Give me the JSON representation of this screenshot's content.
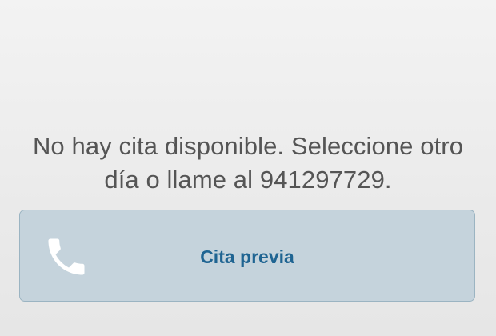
{
  "message": {
    "line1": "No hay cita disponible. Seleccione otro",
    "line2": "día o llame al 941297729."
  },
  "button": {
    "label": "Cita previa",
    "icon": "phone-icon"
  },
  "colors": {
    "message_text": "#555555",
    "button_background": "#c5d3dc",
    "button_border": "#9bb4c2",
    "button_label": "#1f6492",
    "icon": "#ffffff"
  }
}
